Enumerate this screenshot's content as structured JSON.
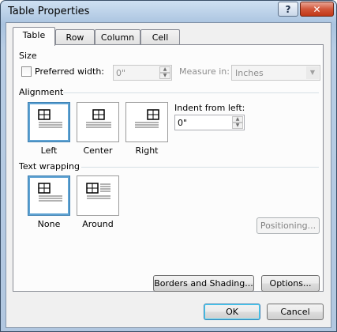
{
  "window": {
    "title": "Table Properties",
    "help_glyph": "?",
    "close_glyph": "✕"
  },
  "tabs": [
    {
      "label": "Table",
      "active": true
    },
    {
      "label": "Row",
      "active": false
    },
    {
      "label": "Column",
      "active": false
    },
    {
      "label": "Cell",
      "active": false
    }
  ],
  "size": {
    "section_label": "Size",
    "preferred_width_label": "Preferred width:",
    "preferred_width_checked": false,
    "preferred_width_value": "0\"",
    "measure_in_label": "Measure in:",
    "measure_in_value": "Inches"
  },
  "alignment": {
    "section_label": "Alignment",
    "options": [
      {
        "label": "Left",
        "selected": true,
        "icon": "table-align-left-icon"
      },
      {
        "label": "Center",
        "selected": false,
        "icon": "table-align-center-icon"
      },
      {
        "label": "Right",
        "selected": false,
        "icon": "table-align-right-icon"
      }
    ],
    "indent_label": "Indent from left:",
    "indent_value": "0\""
  },
  "text_wrapping": {
    "section_label": "Text wrapping",
    "options": [
      {
        "label": "None",
        "selected": true,
        "icon": "wrap-none-icon"
      },
      {
        "label": "Around",
        "selected": false,
        "icon": "wrap-around-icon"
      }
    ],
    "positioning_label": "Positioning..."
  },
  "panel_buttons": {
    "borders_label": "Borders and Shading...",
    "options_label": "Options..."
  },
  "footer": {
    "ok_label": "OK",
    "cancel_label": "Cancel"
  }
}
